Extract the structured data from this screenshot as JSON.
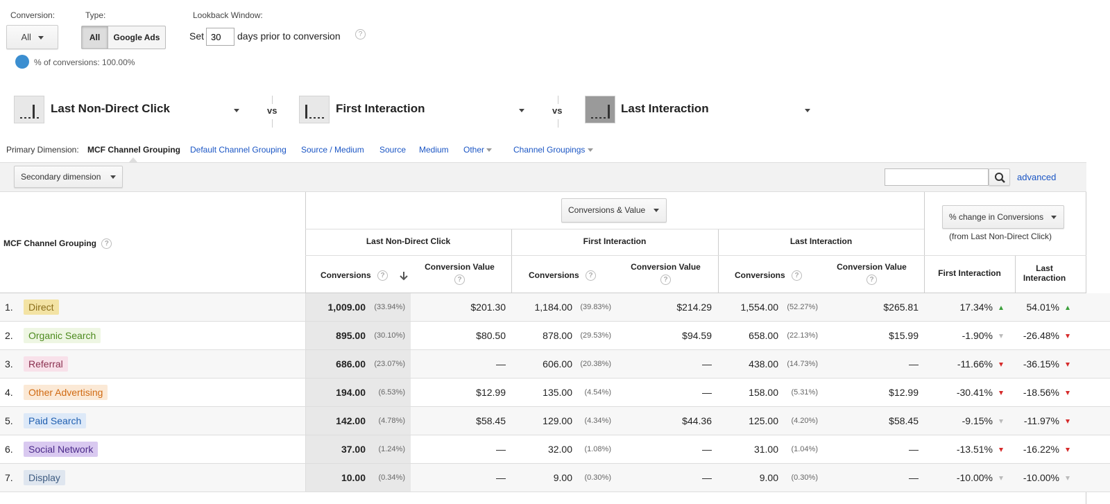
{
  "filters": {
    "conversion_label": "Conversion:",
    "conversion_value": "All",
    "type_label": "Type:",
    "type_options": [
      "All",
      "Google Ads"
    ],
    "lookback_label": "Lookback Window:",
    "set_label": "Set",
    "days_value": "30",
    "days_suffix": "days prior to conversion",
    "pct_conversions": "% of conversions: 100.00%"
  },
  "models": [
    {
      "name": "Last Non-Direct Click"
    },
    {
      "name": "First Interaction"
    },
    {
      "name": "Last Interaction"
    }
  ],
  "vs_label": "vs",
  "primary_dimension": {
    "label": "Primary Dimension:",
    "active": "MCF Channel Grouping",
    "links": [
      "Default Channel Grouping",
      "Source / Medium",
      "Source",
      "Medium",
      "Other",
      "Channel Groupings"
    ]
  },
  "toolbar": {
    "secondary_dimension": "Secondary dimension",
    "advanced": "advanced"
  },
  "table": {
    "dimension_header": "MCF Channel Grouping",
    "metric_selector": "Conversions & Value",
    "change_selector": "% change in Conversions",
    "change_sub": "(from Last Non-Direct Click)",
    "group_headers": [
      "Last Non-Direct Click",
      "First Interaction",
      "Last Interaction"
    ],
    "col_conversions": "Conversions",
    "col_value": "Conversion Value",
    "change_cols": [
      "First Interaction",
      "Last Interaction"
    ],
    "rows": [
      {
        "idx": "1.",
        "name": "Direct",
        "chip_bg": "#f3e3a4",
        "chip_fg": "#8a6d1a",
        "lndc": "1,009.00",
        "lndc_p": "(33.94%)",
        "lndc_v": "$201.30",
        "fi": "1,184.00",
        "fi_p": "(39.83%)",
        "fi_v": "$214.29",
        "li": "1,554.00",
        "li_p": "(52.27%)",
        "li_v": "$265.81",
        "ch1": "17.34%",
        "ch1_dir": "up",
        "ch2": "54.01%",
        "ch2_dir": "up"
      },
      {
        "idx": "2.",
        "name": "Organic Search",
        "chip_bg": "#eef6e3",
        "chip_fg": "#4c8a1e",
        "lndc": "895.00",
        "lndc_p": "(30.10%)",
        "lndc_v": "$80.50",
        "fi": "878.00",
        "fi_p": "(29.53%)",
        "fi_v": "$94.59",
        "li": "658.00",
        "li_p": "(22.13%)",
        "li_v": "$15.99",
        "ch1": "-1.90%",
        "ch1_dir": "downgray",
        "ch2": "-26.48%",
        "ch2_dir": "down"
      },
      {
        "idx": "3.",
        "name": "Referral",
        "chip_bg": "#f8e1ea",
        "chip_fg": "#8a2f4f",
        "lndc": "686.00",
        "lndc_p": "(23.07%)",
        "lndc_v": "—",
        "fi": "606.00",
        "fi_p": "(20.38%)",
        "fi_v": "—",
        "li": "438.00",
        "li_p": "(14.73%)",
        "li_v": "—",
        "ch1": "-11.66%",
        "ch1_dir": "down",
        "ch2": "-36.15%",
        "ch2_dir": "down"
      },
      {
        "idx": "4.",
        "name": "Other Advertising",
        "chip_bg": "#fbe9d6",
        "chip_fg": "#d06a12",
        "lndc": "194.00",
        "lndc_p": "(6.53%)",
        "lndc_v": "$12.99",
        "fi": "135.00",
        "fi_p": "(4.54%)",
        "fi_v": "—",
        "li": "158.00",
        "li_p": "(5.31%)",
        "li_v": "$12.99",
        "ch1": "-30.41%",
        "ch1_dir": "down",
        "ch2": "-18.56%",
        "ch2_dir": "down"
      },
      {
        "idx": "5.",
        "name": "Paid Search",
        "chip_bg": "#dde9f8",
        "chip_fg": "#1f5fb0",
        "lndc": "142.00",
        "lndc_p": "(4.78%)",
        "lndc_v": "$58.45",
        "fi": "129.00",
        "fi_p": "(4.34%)",
        "fi_v": "$44.36",
        "li": "125.00",
        "li_p": "(4.20%)",
        "li_v": "$58.45",
        "ch1": "-9.15%",
        "ch1_dir": "downgray",
        "ch2": "-11.97%",
        "ch2_dir": "down"
      },
      {
        "idx": "6.",
        "name": "Social Network",
        "chip_bg": "#d9c9f0",
        "chip_fg": "#4b2a8a",
        "lndc": "37.00",
        "lndc_p": "(1.24%)",
        "lndc_v": "—",
        "fi": "32.00",
        "fi_p": "(1.08%)",
        "fi_v": "—",
        "li": "31.00",
        "li_p": "(1.04%)",
        "li_v": "—",
        "ch1": "-13.51%",
        "ch1_dir": "down",
        "ch2": "-16.22%",
        "ch2_dir": "down"
      },
      {
        "idx": "7.",
        "name": "Display",
        "chip_bg": "#dfe6ef",
        "chip_fg": "#3c5a80",
        "lndc": "10.00",
        "lndc_p": "(0.34%)",
        "lndc_v": "—",
        "fi": "9.00",
        "fi_p": "(0.30%)",
        "fi_v": "—",
        "li": "9.00",
        "li_p": "(0.30%)",
        "li_v": "—",
        "ch1": "-10.00%",
        "ch1_dir": "downgray",
        "ch2": "-10.00%",
        "ch2_dir": "downgray"
      }
    ]
  },
  "colors": {
    "link": "#1a55c4",
    "up": "#3a9f3a",
    "down": "#d62b2b"
  }
}
